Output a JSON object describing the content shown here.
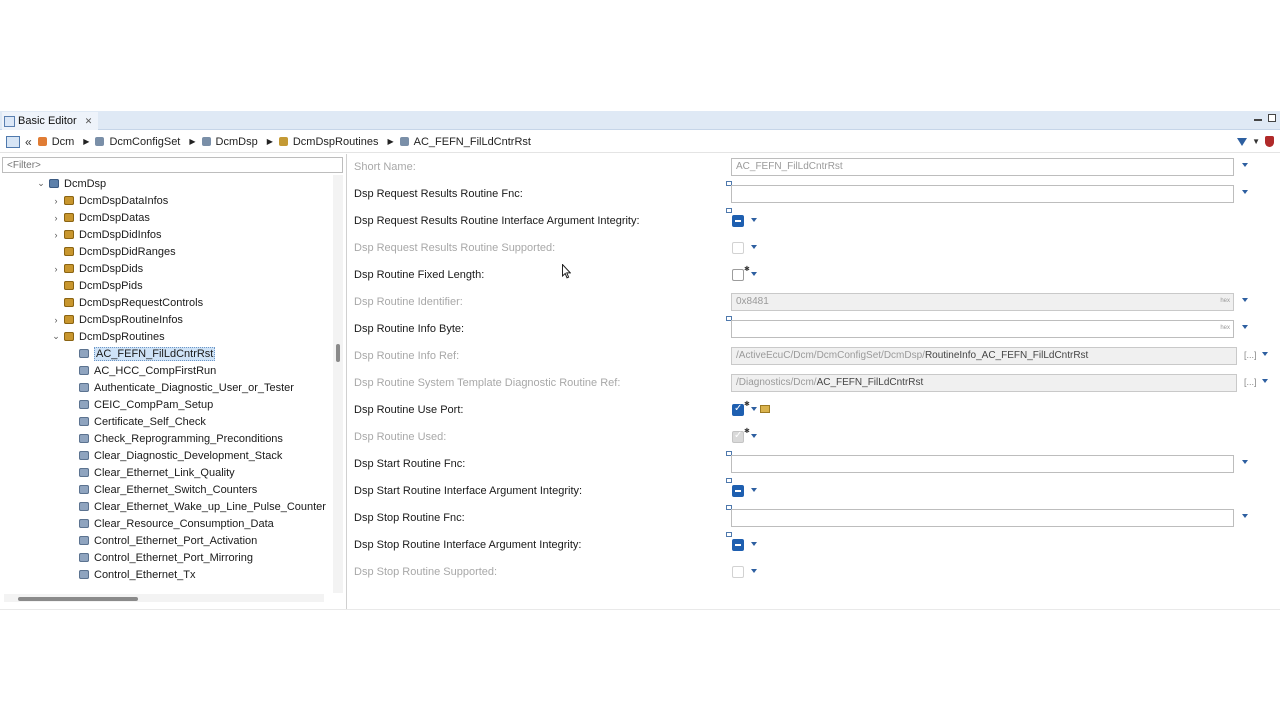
{
  "editor": {
    "tab_title": "Basic Editor",
    "tab_close": "✕"
  },
  "breadcrumb": {
    "back": "«",
    "items": [
      "Dcm",
      "DcmConfigSet",
      "DcmDsp",
      "DcmDspRoutines",
      "AC_FEFN_FilLdCntrRst"
    ]
  },
  "filter": {
    "placeholder": "<Filter>"
  },
  "tree": {
    "items": [
      {
        "label": "DcmDsp",
        "twisty": "⌄",
        "icon": "node"
      },
      {
        "label": "DcmDspDataInfos",
        "twisty": "›",
        "icon": "folder"
      },
      {
        "label": "DcmDspDatas",
        "twisty": "›",
        "icon": "folder"
      },
      {
        "label": "DcmDspDidInfos",
        "twisty": "›",
        "icon": "folder"
      },
      {
        "label": "DcmDspDidRanges",
        "twisty": "",
        "icon": "folder"
      },
      {
        "label": "DcmDspDids",
        "twisty": "›",
        "icon": "folder"
      },
      {
        "label": "DcmDspPids",
        "twisty": "",
        "icon": "folder"
      },
      {
        "label": "DcmDspRequestControls",
        "twisty": "",
        "icon": "folder"
      },
      {
        "label": "DcmDspRoutineInfos",
        "twisty": "›",
        "icon": "folder"
      },
      {
        "label": "DcmDspRoutines",
        "twisty": "⌄",
        "icon": "folder"
      },
      {
        "label": "AC_FEFN_FilLdCntrRst",
        "twisty": "",
        "icon": "leaf"
      },
      {
        "label": "AC_HCC_CompFirstRun",
        "twisty": "",
        "icon": "leaf"
      },
      {
        "label": "Authenticate_Diagnostic_User_or_Tester",
        "twisty": "",
        "icon": "leaf"
      },
      {
        "label": "CEIC_CompPam_Setup",
        "twisty": "",
        "icon": "leaf"
      },
      {
        "label": "Certificate_Self_Check",
        "twisty": "",
        "icon": "leaf"
      },
      {
        "label": "Check_Reprogramming_Preconditions",
        "twisty": "",
        "icon": "leaf"
      },
      {
        "label": "Clear_Diagnostic_Development_Stack",
        "twisty": "",
        "icon": "leaf"
      },
      {
        "label": "Clear_Ethernet_Link_Quality",
        "twisty": "",
        "icon": "leaf"
      },
      {
        "label": "Clear_Ethernet_Switch_Counters",
        "twisty": "",
        "icon": "leaf"
      },
      {
        "label": "Clear_Ethernet_Wake_up_Line_Pulse_Counter",
        "twisty": "",
        "icon": "leaf"
      },
      {
        "label": "Clear_Resource_Consumption_Data",
        "twisty": "",
        "icon": "leaf"
      },
      {
        "label": "Control_Ethernet_Port_Activation",
        "twisty": "",
        "icon": "leaf"
      },
      {
        "label": "Control_Ethernet_Port_Mirroring",
        "twisty": "",
        "icon": "leaf"
      },
      {
        "label": "Control_Ethernet_Tx",
        "twisty": "",
        "icon": "leaf"
      }
    ]
  },
  "form": {
    "short_name_label": "Short Name:",
    "short_name_value": "AC_FEFN_FilLdCntrRst",
    "req_results_fnc_label": "Dsp Request Results Routine Fnc:",
    "req_results_iface_label": "Dsp Request Results Routine Interface Argument Integrity:",
    "req_results_supported_label": "Dsp Request Results Routine Supported:",
    "fixed_length_label": "Dsp Routine Fixed Length:",
    "identifier_label": "Dsp Routine Identifier:",
    "identifier_value": "0x8481",
    "hex_tag": "hex",
    "info_byte_label": "Dsp Routine Info Byte:",
    "info_ref_label": "Dsp Routine Info Ref:",
    "info_ref_prefix": "/ActiveEcuC/Dcm/DcmConfigSet/DcmDsp/",
    "info_ref_name": "RoutineInfo_AC_FEFN_FilLdCntrRst",
    "sys_template_label": "Dsp Routine System Template Diagnostic Routine Ref:",
    "sys_template_prefix": "/Diagnostics/Dcm/",
    "sys_template_name": "AC_FEFN_FilLdCntrRst",
    "browse": "[...]",
    "use_port_label": "Dsp Routine Use Port:",
    "used_label": "Dsp Routine Used:",
    "start_fnc_label": "Dsp Start Routine Fnc:",
    "start_iface_label": "Dsp Start Routine Interface Argument Integrity:",
    "stop_fnc_label": "Dsp Stop Routine Fnc:",
    "stop_iface_label": "Dsp Stop Routine Interface Argument Integrity:",
    "stop_supported_label": "Dsp Stop Routine Supported:"
  },
  "colors": {
    "accent": "#1e5fb0",
    "tab_bar": "#dfe9f5",
    "selection": "#cfe3f7"
  }
}
